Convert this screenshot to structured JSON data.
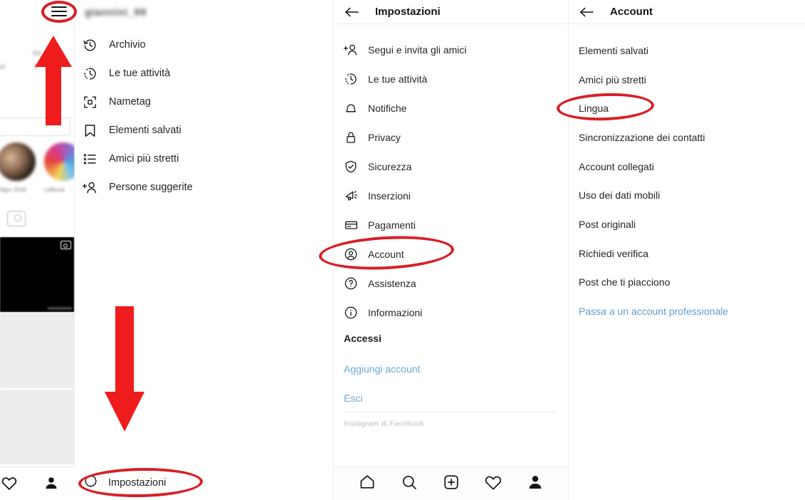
{
  "meta": {
    "app": "Instagram",
    "accent_red": "#d81f26",
    "link_blue": "#5b9fd6",
    "text_dark": "#262626"
  },
  "left_panel": {
    "drawer": {
      "username": "giannini_99",
      "items": [
        {
          "label": "Archivio",
          "icon": "archive-clock-icon"
        },
        {
          "label": "Le tue attività",
          "icon": "activity-clock-icon"
        },
        {
          "label": "Nametag",
          "icon": "nametag-icon"
        },
        {
          "label": "Elementi salvati",
          "icon": "bookmark-icon"
        },
        {
          "label": "Amici più stretti",
          "icon": "close-friends-list-icon"
        },
        {
          "label": "Persone suggerite",
          "icon": "add-person-icon"
        }
      ],
      "settings": {
        "label": "Impostazioni",
        "icon": "gear-icon"
      }
    },
    "backdrop": {
      "story_labels": [
        "Sigur 2018",
        "Lidikock"
      ],
      "blur_texts": [
        "er",
        "99",
        "5"
      ]
    },
    "bottom_nav": [
      {
        "icon": "heart-icon",
        "name": "activity-tab"
      },
      {
        "icon": "profile-filled-icon",
        "name": "profile-tab"
      }
    ]
  },
  "mid_panel": {
    "header": {
      "title": "Impostazioni",
      "back_icon": "back-arrow-icon"
    },
    "items": [
      {
        "label": "Segui e invita gli amici",
        "icon": "add-person-icon"
      },
      {
        "label": "Le tue attività",
        "icon": "activity-clock-icon"
      },
      {
        "label": "Notifiche",
        "icon": "bell-icon"
      },
      {
        "label": "Privacy",
        "icon": "lock-icon"
      },
      {
        "label": "Sicurezza",
        "icon": "shield-check-icon"
      },
      {
        "label": "Inserzioni",
        "icon": "megaphone-icon"
      },
      {
        "label": "Pagamenti",
        "icon": "credit-card-icon"
      },
      {
        "label": "Account",
        "icon": "account-circle-icon"
      },
      {
        "label": "Assistenza",
        "icon": "question-circle-icon"
      },
      {
        "label": "Informazioni",
        "icon": "info-circle-icon"
      }
    ],
    "section_title": "Accessi",
    "links": [
      {
        "label": "Aggiungi account"
      },
      {
        "label": "Esci"
      }
    ],
    "footnote": "Instagram di Facebook",
    "bottom_nav": [
      {
        "icon": "home-icon",
        "name": "home-tab"
      },
      {
        "icon": "search-icon",
        "name": "search-tab"
      },
      {
        "icon": "add-square-icon",
        "name": "create-tab"
      },
      {
        "icon": "heart-icon",
        "name": "activity-tab"
      },
      {
        "icon": "profile-filled-icon",
        "name": "profile-tab"
      }
    ]
  },
  "right_panel": {
    "header": {
      "title": "Account",
      "back_icon": "back-arrow-icon"
    },
    "items": [
      {
        "label": "Elementi salvati"
      },
      {
        "label": "Amici più stretti"
      },
      {
        "label": "Lingua"
      },
      {
        "label": "Sincronizzazione dei contatti"
      },
      {
        "label": "Account collegati"
      },
      {
        "label": "Uso dei dati mobili"
      },
      {
        "label": "Post originali"
      },
      {
        "label": "Richiedi verifica"
      },
      {
        "label": "Post che ti piacciono"
      }
    ],
    "pro_link": "Passa a un account professionale"
  },
  "annotations": {
    "ellipses": [
      {
        "name": "hamburger-highlight",
        "target": "hamburger-menu-button"
      },
      {
        "name": "impostazioni-highlight",
        "target": "drawer-settings"
      },
      {
        "name": "account-highlight",
        "target": "mid-item-account"
      },
      {
        "name": "lingua-highlight",
        "target": "right-item-lingua"
      }
    ],
    "arrows": [
      {
        "name": "arrow-up-to-hamburger",
        "direction": "up",
        "color": "#ee1c1c"
      },
      {
        "name": "arrow-down-to-impostazioni",
        "direction": "down",
        "color": "#ee1c1c"
      }
    ]
  }
}
